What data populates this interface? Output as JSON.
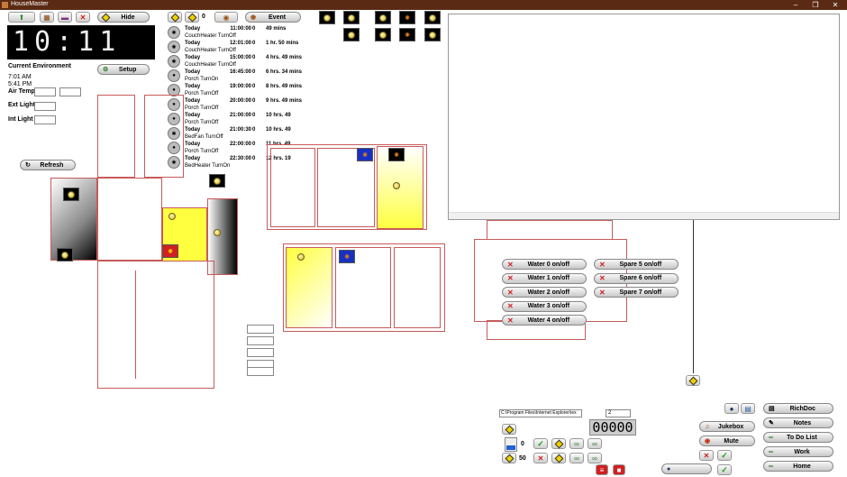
{
  "window": {
    "title": "HouseMaster"
  },
  "toolbar": {
    "hide_label": "Hide",
    "event_count": "0",
    "event_label": "Event"
  },
  "clock": {
    "time": "10:11"
  },
  "environment": {
    "heading": "Current Environment",
    "sunrise": "7:01 AM",
    "sunset": "5:41 PM",
    "air_temp_label": "Air Temp",
    "ext_light_label": "Ext Light",
    "int_light_label": "Int Light",
    "setup_label": "Setup",
    "refresh_label": "Refresh"
  },
  "events": [
    {
      "date": "Today",
      "time": "11:00:00",
      "num": "0",
      "remaining": "49 mins",
      "device": "CouchHeater",
      "action": "TurnOff",
      "icon": "heater-icon"
    },
    {
      "date": "Today",
      "time": "12:01:00",
      "num": "0",
      "remaining": "1 hr. 50 mins",
      "device": "CouchHeater",
      "action": "TurnOff",
      "icon": "heater-icon"
    },
    {
      "date": "Today",
      "time": "15:00:00",
      "num": "0",
      "remaining": "4 hrs. 49 mins",
      "device": "CouchHeater",
      "action": "TurnOff",
      "icon": "heater-icon"
    },
    {
      "date": "Today",
      "time": "16:45:00",
      "num": "0",
      "remaining": "6 hrs. 34 mins",
      "device": "Porch",
      "action": "TurnOn",
      "icon": "bulb-icon"
    },
    {
      "date": "Today",
      "time": "19:00:00",
      "num": "0",
      "remaining": "8 hrs. 49 mins",
      "device": "Porch",
      "action": "TurnOff",
      "icon": "bulb-icon"
    },
    {
      "date": "Today",
      "time": "20:00:00",
      "num": "0",
      "remaining": "9 hrs. 49 mins",
      "device": "Porch",
      "action": "TurnOff",
      "icon": "bulb-icon"
    },
    {
      "date": "Today",
      "time": "21:00:00",
      "num": "0",
      "remaining": "10 hrs. 49",
      "device": "Porch",
      "action": "TurnOff",
      "icon": "bulb-icon"
    },
    {
      "date": "Today",
      "time": "21:00:30",
      "num": "0",
      "remaining": "10 hrs. 49",
      "device": "BedFan",
      "action": "TurnOff",
      "icon": "fan-icon"
    },
    {
      "date": "Today",
      "time": "22:00:00",
      "num": "0",
      "remaining": "11 hrs. 49",
      "device": "Porch",
      "action": "TurnOff",
      "icon": "bulb-icon"
    },
    {
      "date": "Today",
      "time": "22:30:00",
      "num": "0",
      "remaining": "12 hrs. 19",
      "device": "BedHeater",
      "action": "TurnOn",
      "icon": "heater-icon"
    }
  ],
  "water": [
    {
      "label": "Water 0  on/off"
    },
    {
      "label": "Water 1  on/off"
    },
    {
      "label": "Water 2  on/off"
    },
    {
      "label": "Water 3  on/off"
    },
    {
      "label": "Water 4  on/off"
    }
  ],
  "spares": [
    {
      "label": "Spare 5  on/off"
    },
    {
      "label": "Spare 6  on/off"
    },
    {
      "label": "Spare 7  on/off"
    }
  ],
  "media": {
    "path": "C:\\Program Files\\Internet Explorer\\iex",
    "spinner_value": "2",
    "counter": "00000",
    "volume_value": "0",
    "balance_value": "50",
    "jukebox_label": "Jukebox",
    "mute_label": "Mute"
  },
  "shortcuts": {
    "richdoc": "RichDoc",
    "notes": "Notes",
    "todo": "To Do List",
    "work": "Work",
    "home": "Home"
  },
  "colors": {
    "titlebar": "#5a2a14",
    "walls": "#c85a5a",
    "lit_room": "#ffff40",
    "accent_yellow": "#f0d000"
  }
}
